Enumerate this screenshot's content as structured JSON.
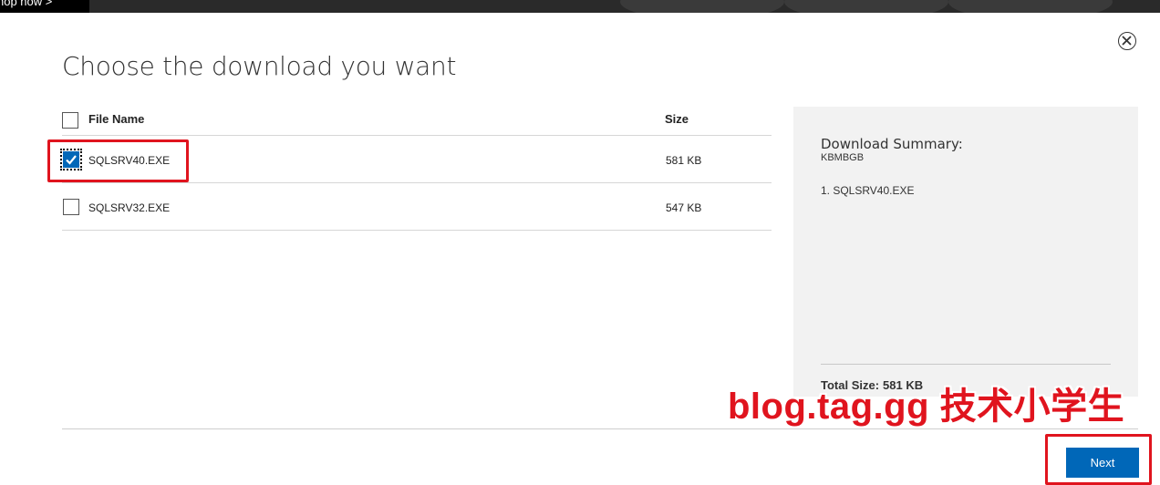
{
  "background_banner": {
    "link_text": "hop now"
  },
  "dialog": {
    "title": "Choose the download you want",
    "table": {
      "headers": {
        "file_name": "File Name",
        "size": "Size"
      },
      "rows": [
        {
          "name": "SQLSRV40.EXE",
          "size": "581 KB",
          "checked": true
        },
        {
          "name": "SQLSRV32.EXE",
          "size": "547 KB",
          "checked": false
        }
      ]
    },
    "summary": {
      "title": "Download Summary:",
      "subtitle": "KBMBGB",
      "items": [
        "1. SQLSRV40.EXE"
      ],
      "total_label": "Total Size:",
      "total_value": "581 KB"
    },
    "next_label": "Next"
  },
  "watermark": "blog.tag.gg 技术小学生",
  "colors": {
    "accent": "#0067b8",
    "annotation": "#e0141e",
    "summary_bg": "#f2f2f2"
  }
}
